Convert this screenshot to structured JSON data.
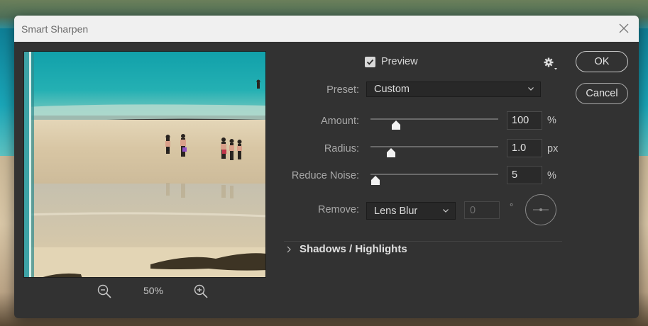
{
  "window": {
    "title": "Smart Sharpen"
  },
  "buttons": {
    "ok": "OK",
    "cancel": "Cancel"
  },
  "preview": {
    "label": "Preview",
    "checked": true
  },
  "preset": {
    "label": "Preset:",
    "value": "Custom"
  },
  "amount": {
    "label": "Amount:",
    "value": "100",
    "unit": "%",
    "slider_fraction": 0.2
  },
  "radius": {
    "label": "Radius:",
    "value": "1.0",
    "unit": "px",
    "slider_fraction": 0.16
  },
  "reduce_noise": {
    "label": "Reduce Noise:",
    "value": "5",
    "unit": "%",
    "slider_fraction": 0.04
  },
  "remove": {
    "label": "Remove:",
    "value": "Lens Blur",
    "angle": "0",
    "angle_unit": "°"
  },
  "section": {
    "shadows_highlights": "Shadows / Highlights"
  },
  "zoom": {
    "level": "50%"
  },
  "colors": {
    "dialog_bg": "#323232",
    "titlebar_bg": "#f0f0f0"
  },
  "icons": [
    "close-icon",
    "checkbox-check-icon",
    "gear-icon",
    "chevron-down-icon",
    "zoom-out-icon",
    "zoom-in-icon",
    "chevron-right-icon",
    "angle-dial-icon",
    "slider-thumb-icon"
  ]
}
